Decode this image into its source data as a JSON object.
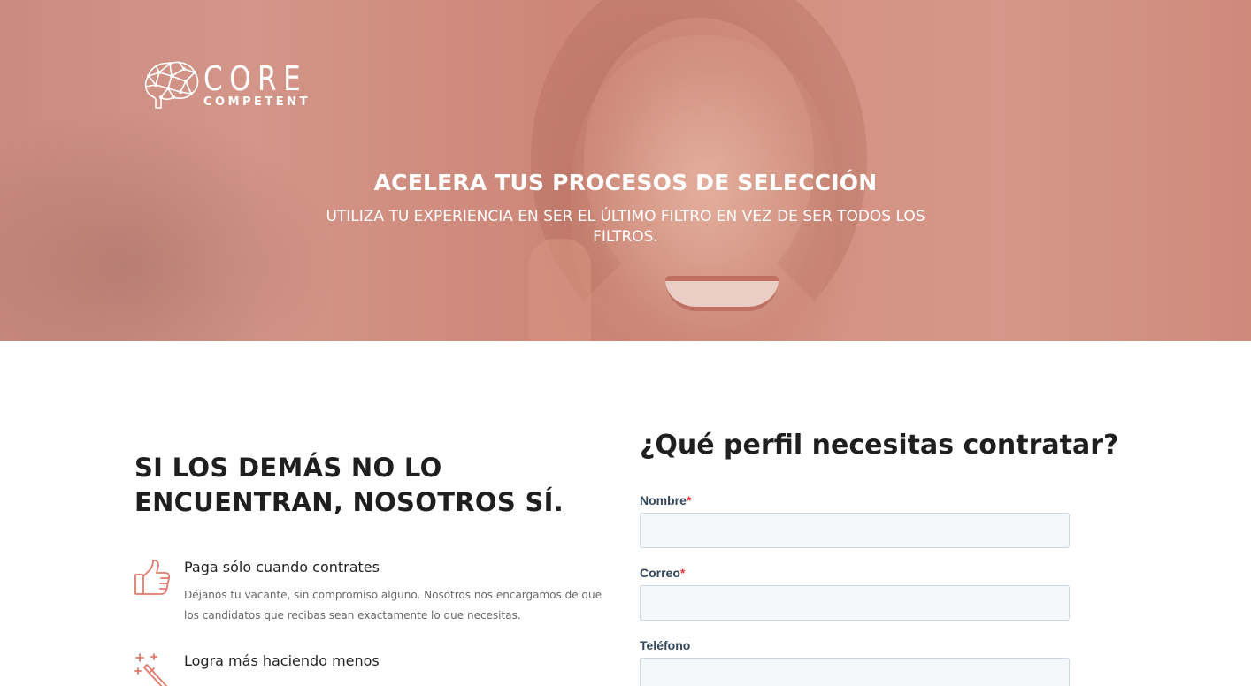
{
  "brand": {
    "name_line1": "CORE",
    "name_line2": "COMPETENT",
    "icon": "brain-network-icon"
  },
  "hero": {
    "title": "ACELERA TUS PROCESOS DE SELECCIÓN",
    "subtitle": "UTILIZA TU EXPERIENCIA EN SER EL ÚLTIMO FILTRO EN VEZ DE SER TODOS LOS FILTROS."
  },
  "benefits": {
    "title": "SI LOS DEMÁS NO LO ENCUENTRAN, NOSOTROS SÍ.",
    "items": [
      {
        "icon": "thumbs-up-icon",
        "title": "Paga sólo cuando contrates",
        "description": "Déjanos tu vacante, sin compromiso alguno. Nosotros nos encargamos de que los candidatos que recibas sean exactamente lo que necesitas."
      },
      {
        "icon": "magic-wand-icon",
        "title": "Logra más haciendo menos",
        "description": ""
      }
    ]
  },
  "form": {
    "title": "¿Qué perfil necesitas contratar?",
    "fields": [
      {
        "label": "Nombre",
        "required_mark": "*",
        "value": ""
      },
      {
        "label": "Correo",
        "required_mark": "*",
        "value": ""
      },
      {
        "label": "Teléfono",
        "required_mark": "",
        "value": ""
      }
    ]
  },
  "colors": {
    "accent": "#e07a6c",
    "heading": "#1f1f1f",
    "label": "#33475b",
    "required": "#e53935",
    "input_bg": "#f5f8fa",
    "input_border": "#cbd6e2"
  }
}
